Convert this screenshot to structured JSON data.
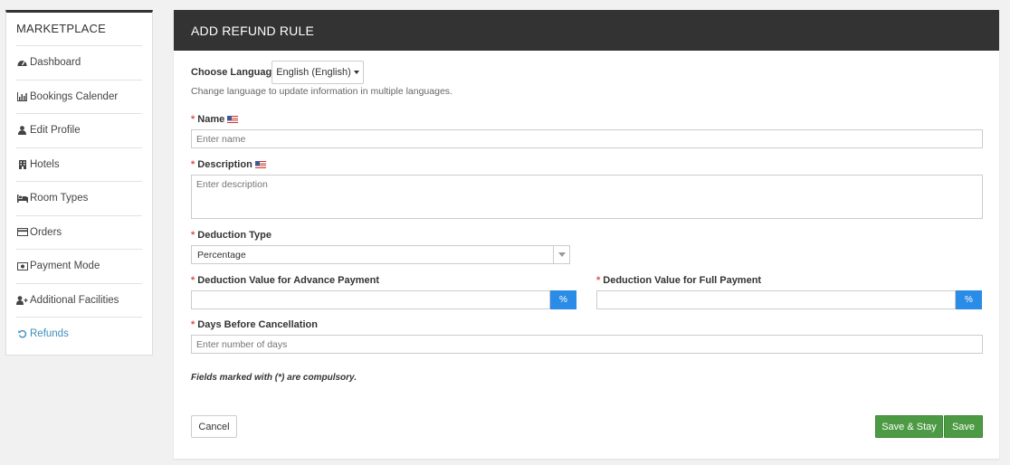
{
  "sidebar": {
    "title": "MARKETPLACE",
    "items": [
      {
        "label": "Dashboard",
        "icon": "dashboard-icon"
      },
      {
        "label": "Bookings Calender",
        "icon": "bar-chart-icon"
      },
      {
        "label": "Edit Profile",
        "icon": "user-icon"
      },
      {
        "label": "Hotels",
        "icon": "building-icon"
      },
      {
        "label": "Room Types",
        "icon": "bed-icon"
      },
      {
        "label": "Orders",
        "icon": "credit-card-icon"
      },
      {
        "label": "Payment Mode",
        "icon": "money-icon"
      },
      {
        "label": "Additional Facilities",
        "icon": "user-plus-icon"
      },
      {
        "label": "Refunds",
        "icon": "undo-icon",
        "active": true
      }
    ]
  },
  "form": {
    "header": "ADD REFUND RULE",
    "language": {
      "label": "Choose Language:",
      "value": "English (English)",
      "hint": "Change language to update information in multiple languages."
    },
    "required_mark": "*",
    "name": {
      "label": "Name",
      "placeholder": "Enter name"
    },
    "description": {
      "label": "Description",
      "placeholder": "Enter description"
    },
    "deduction_type": {
      "label": "Deduction Type",
      "value": "Percentage"
    },
    "advance": {
      "label": "Deduction Value for Advance Payment",
      "value": "",
      "addon": "%"
    },
    "full": {
      "label": "Deduction Value for Full Payment",
      "value": "",
      "addon": "%"
    },
    "days": {
      "label": "Days Before Cancellation",
      "placeholder": "Enter number of days"
    },
    "note": "Fields marked with (*) are compulsory.",
    "buttons": {
      "cancel": "Cancel",
      "save_stay": "Save & Stay",
      "save": "Save"
    }
  },
  "colors": {
    "header_bg": "#333333",
    "accent": "#3c8dbc",
    "addon": "#2a8ce6",
    "success": "#4d9a45",
    "required": "#d9534f"
  }
}
